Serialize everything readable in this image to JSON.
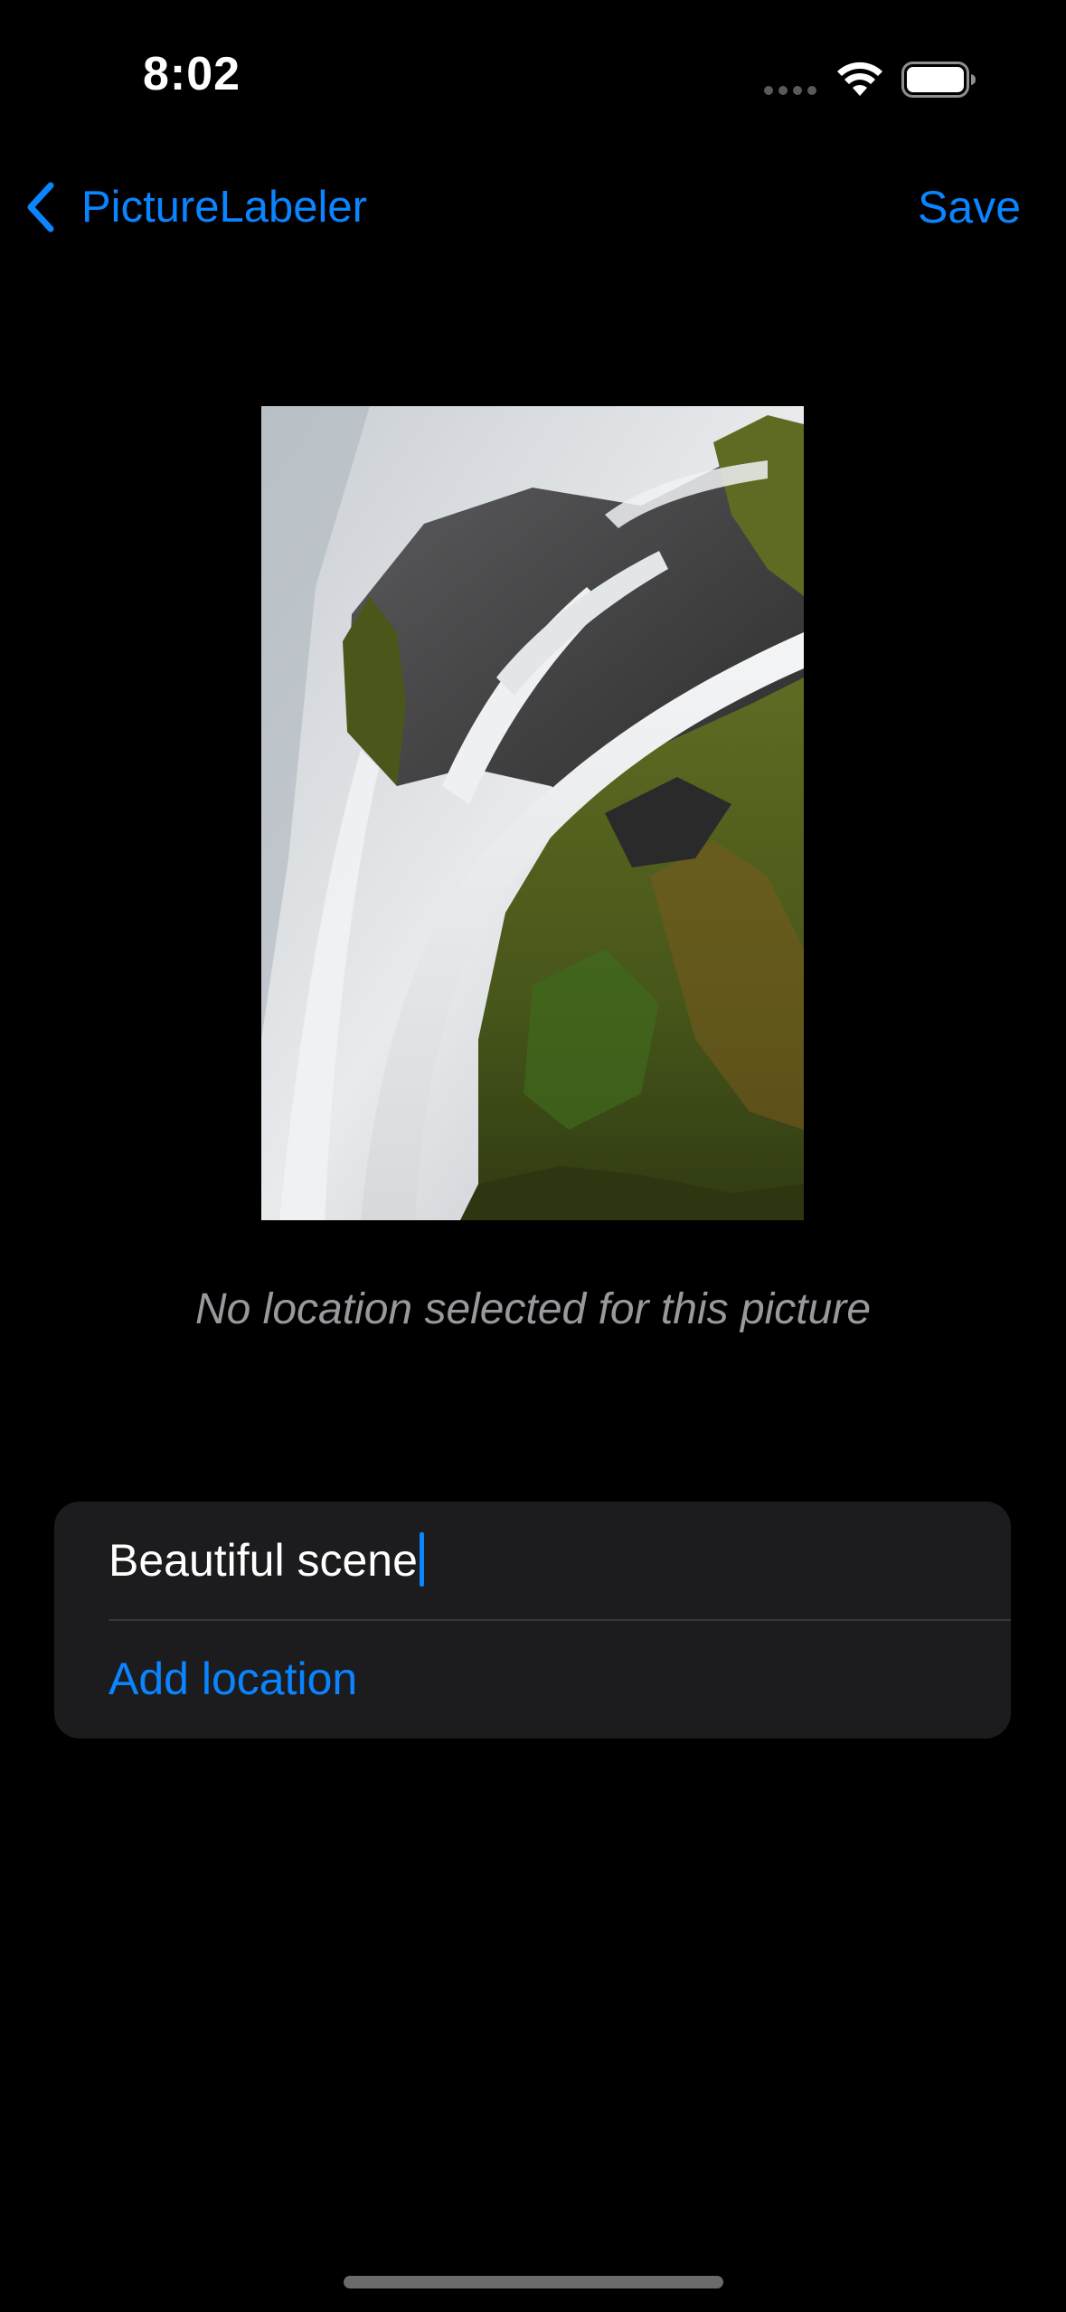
{
  "status_bar": {
    "time": "8:02",
    "icons": [
      "cellular-signal-icon",
      "wifi-icon",
      "battery-icon"
    ]
  },
  "nav": {
    "back_label": "PictureLabeler",
    "back_icon": "chevron-left-icon",
    "save_label": "Save"
  },
  "photo": {
    "description_icon": "waterfall-photo"
  },
  "location_note": "No location selected for this picture",
  "form": {
    "caption_value": "Beautiful scene",
    "add_location_label": "Add location"
  },
  "colors": {
    "accent": "#0a84ff",
    "background": "#000000",
    "card": "#1c1c1e",
    "secondary_text": "#98989d"
  }
}
